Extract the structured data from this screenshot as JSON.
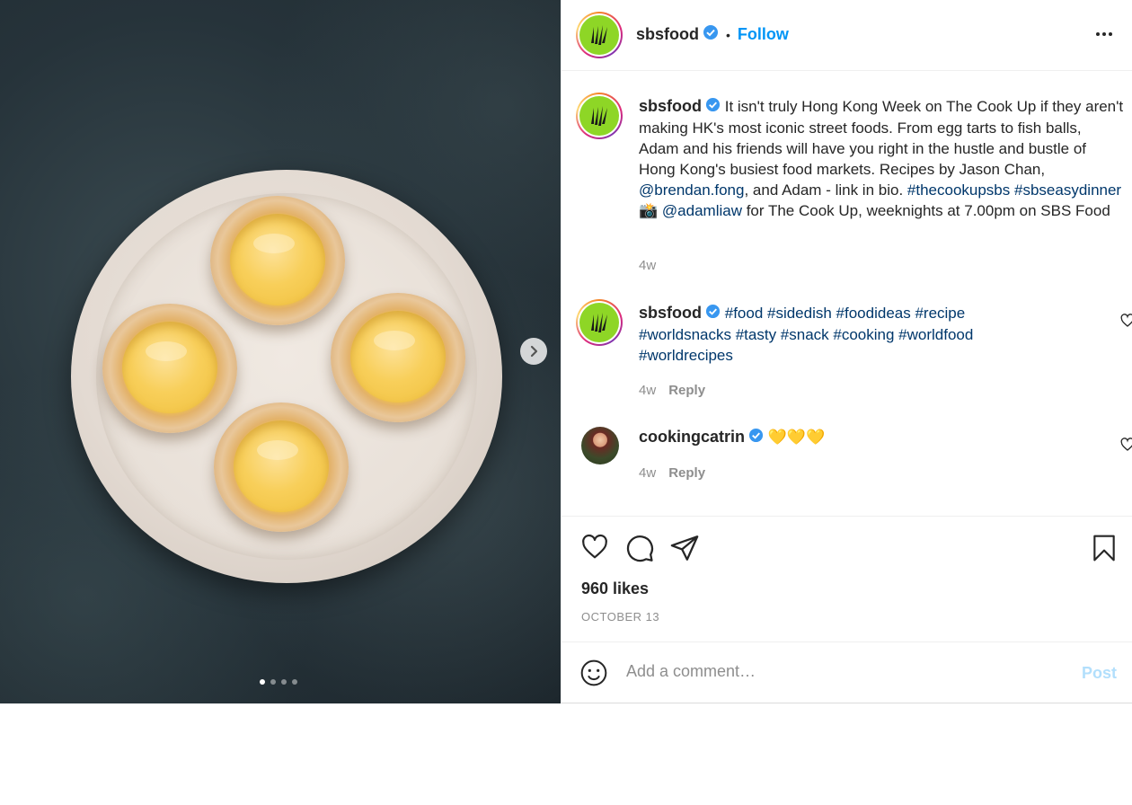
{
  "post": {
    "image_alt": "Egg tarts on a plate",
    "carousel": {
      "count": 4,
      "active_index": 0
    }
  },
  "header": {
    "username": "sbsfood",
    "separator": "•",
    "follow_label": "Follow"
  },
  "caption": {
    "username": "sbsfood",
    "text_part1": "It isn't truly Hong Kong Week on The Cook Up if they aren't making HK's most iconic street foods. From egg tarts to fish balls, Adam and his friends will have you right in the hustle and bustle of Hong Kong's busiest food markets. Recipes by Jason Chan, ",
    "mention1": "@brendan.fong",
    "text_part2": ", and Adam - link in bio. ",
    "hashtag1": "#thecookupsbs",
    "hashtag2": "#sbseasydinner",
    "emoji": "📸",
    "mention2": "@adamliaw",
    "text_part3": " for The Cook Up, weeknights at 7.00pm on SBS Food",
    "time": "4w"
  },
  "comments": [
    {
      "username": "sbsfood",
      "hashtags": "#food #sidedish #foodideas #recipe #worldsnacks #tasty #snack #cooking #worldfood #worldrecipes",
      "time": "4w",
      "reply_label": "Reply"
    },
    {
      "username": "cookingcatrin",
      "text": "💛💛💛",
      "time": "4w",
      "reply_label": "Reply"
    }
  ],
  "actions": {
    "likes": "960 likes",
    "date": "OCTOBER 13"
  },
  "add_comment": {
    "placeholder": "Add a comment…",
    "post_label": "Post"
  },
  "colors": {
    "brand_green": "#8ed626",
    "link": "#00376b",
    "follow_blue": "#0095f6",
    "muted": "#8e8e8e"
  }
}
